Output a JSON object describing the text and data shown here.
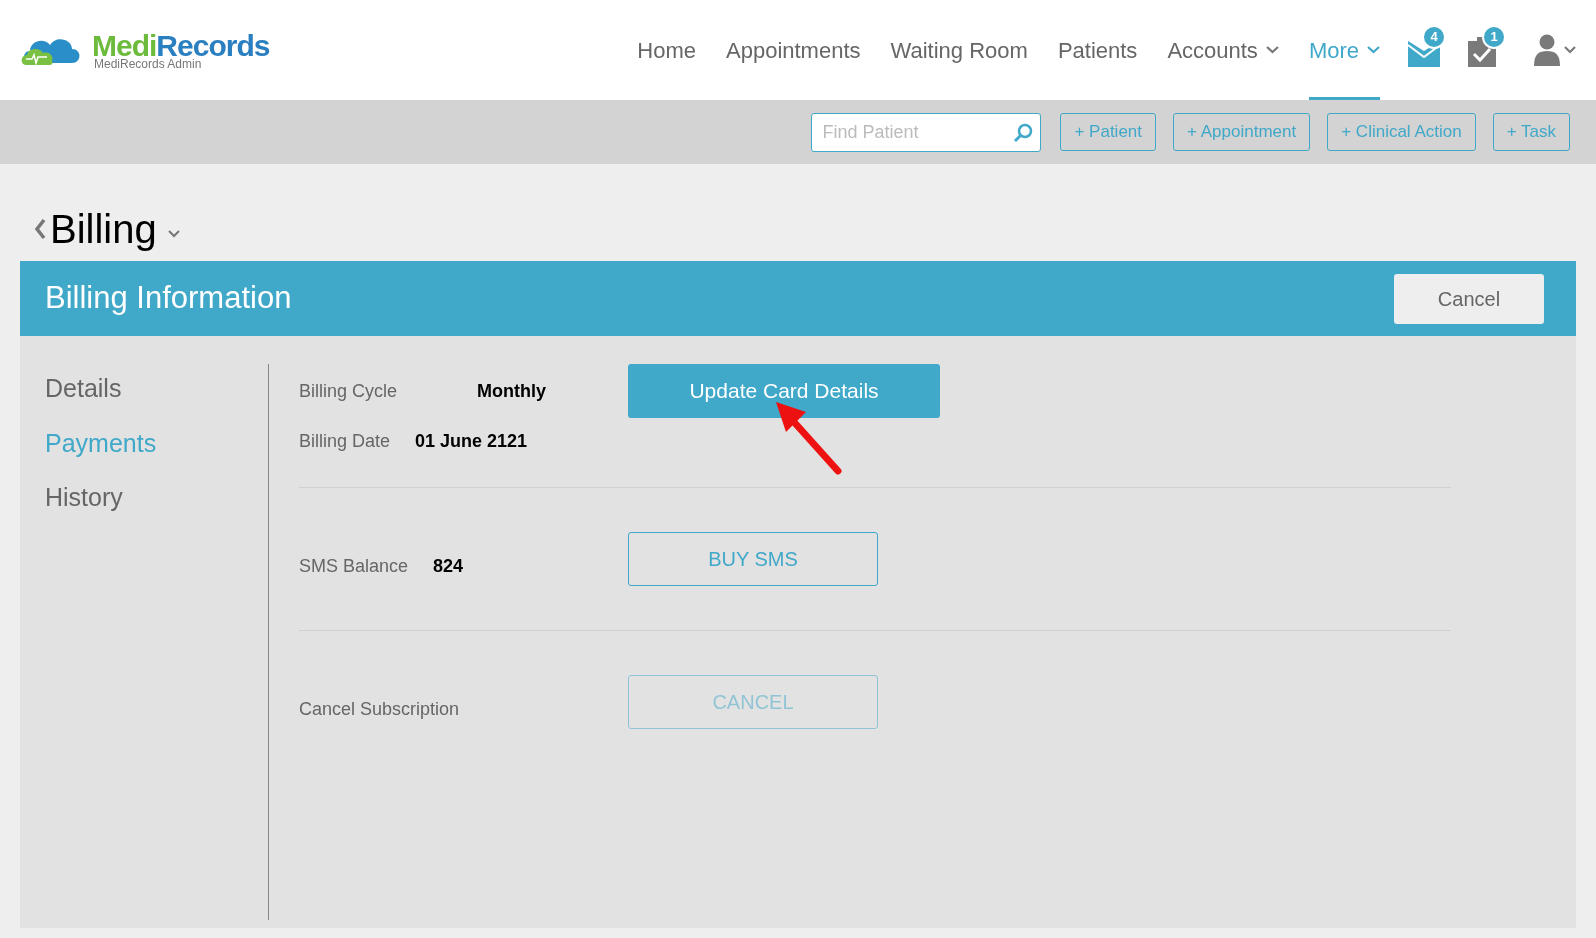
{
  "logo": {
    "first": "Medi",
    "second": "Records",
    "subtitle": "MediRecords Admin"
  },
  "nav": [
    {
      "label": "Home",
      "selected": false,
      "dropdown": false
    },
    {
      "label": "Appointments",
      "selected": false,
      "dropdown": false
    },
    {
      "label": "Waiting Room",
      "selected": false,
      "dropdown": false
    },
    {
      "label": "Patients",
      "selected": false,
      "dropdown": false
    },
    {
      "label": "Accounts",
      "selected": false,
      "dropdown": true
    },
    {
      "label": "More",
      "selected": true,
      "dropdown": true
    }
  ],
  "notifications": [
    {
      "kind": "mail",
      "badge": "4"
    },
    {
      "kind": "tasks",
      "badge": "1"
    }
  ],
  "toolbar": {
    "search": {
      "placeholder": "Find Patient"
    },
    "buttons": [
      "+ Patient",
      "+ Appointment",
      "+ Clinical Action",
      "+ Task"
    ]
  },
  "page_title": "Billing",
  "panel": {
    "title": "Billing Information",
    "cancel": "Cancel"
  },
  "sidebar": [
    {
      "label": "Details",
      "selected": false
    },
    {
      "label": "Payments",
      "selected": true
    },
    {
      "label": "History",
      "selected": false
    }
  ],
  "sections": [
    {
      "fields": [
        {
          "label": "Billing Cycle",
          "value": "Monthly"
        },
        {
          "label": "Billing Date",
          "value": "01 June 2121"
        }
      ],
      "action": {
        "label": "Update Card Details",
        "kind": "primary",
        "disabled": false
      }
    },
    {
      "fields": [
        {
          "label": "SMS Balance",
          "value": "824"
        }
      ],
      "action": {
        "label": "BUY SMS",
        "kind": "outline",
        "disabled": false
      }
    },
    {
      "fields": [
        {
          "label": "Cancel Subscription"
        }
      ],
      "action": {
        "label": "CANCEL",
        "kind": "outline",
        "disabled": true
      }
    }
  ]
}
